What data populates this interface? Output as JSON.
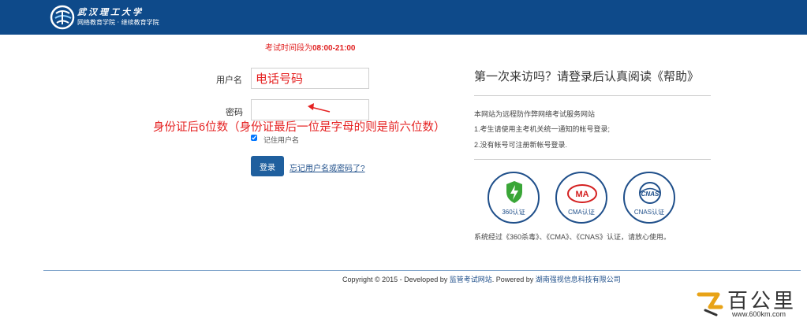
{
  "header": {
    "school_name": "武汉理工大学",
    "school_sub": "网络教育学院 · 继续教育学院"
  },
  "exam_time": {
    "prefix": "考试时间段为",
    "range": "08:00-21:00"
  },
  "form": {
    "username_label": "用户名",
    "username_value": "电话号码",
    "password_label": "密码",
    "annotation": "身份证后6位数（身份证最后一位是字母的则是前六位数）",
    "remember_label": "记住用户名",
    "remember_checked": true,
    "login_button": "登录",
    "forgot_link": "忘记用户名或密码了?"
  },
  "help": {
    "title": "第一次来访吗？请登录后认真阅读《帮助》",
    "intro": "本网站为远程防作弊网络考试服务网站",
    "item1": "1.考生请使用主考机关统一通知的帐号登录;",
    "item2": "2.没有帐号可注册新帐号登录.",
    "badges": [
      {
        "label": "360认证",
        "icon": "360-shield-icon"
      },
      {
        "label": "CMA认证",
        "icon": "cma-icon"
      },
      {
        "label": "CNAS认证",
        "icon": "cnas-icon"
      }
    ],
    "cert_note": "系统经过《360杀毒》、《CMA》、《CNAS》认证，请放心使用。"
  },
  "footer": {
    "copyright_prefix": "Copyright © 2015 - Developed by",
    "developer": "监管考试网站",
    "powered_prefix": ". Powered by",
    "powered_by": "湖南强视信息科技有限公司"
  },
  "watermark": {
    "text": "百公里",
    "url": "www.600km.com"
  },
  "colors": {
    "header_bg": "#0e4a8a",
    "accent_red": "#e52222",
    "button_blue": "#1f5f9e",
    "link_blue": "#1f4f8a"
  }
}
